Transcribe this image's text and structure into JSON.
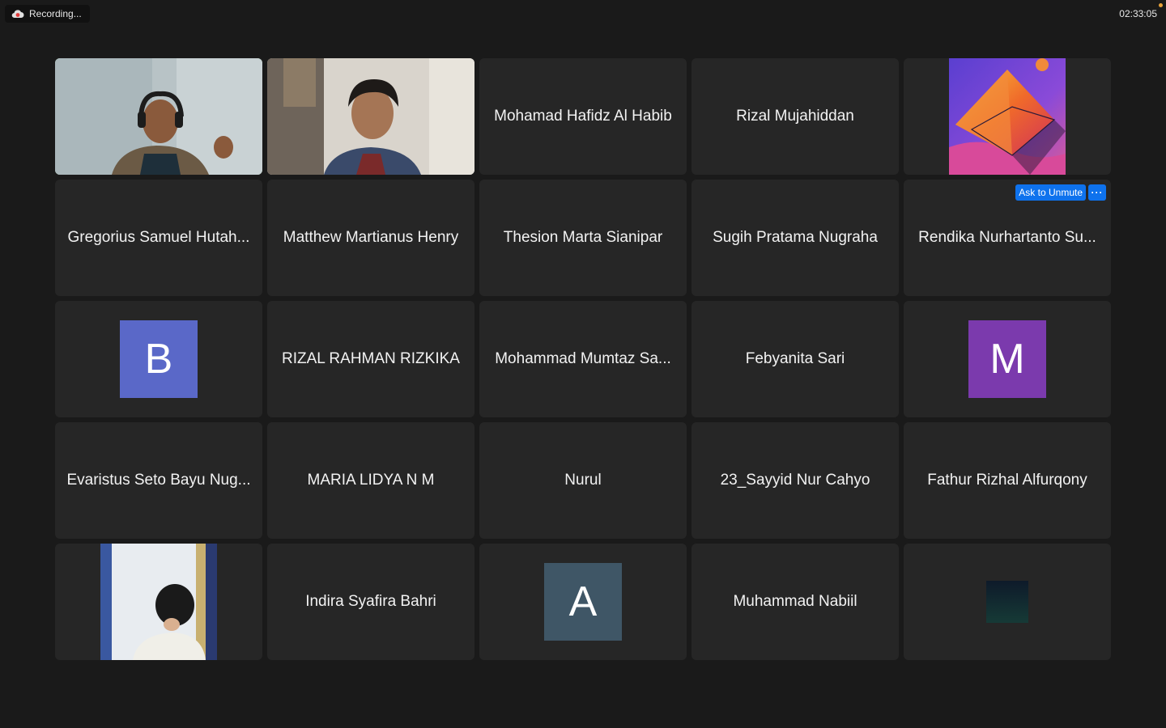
{
  "topbar": {
    "recording_label": "Recording...",
    "recording_icon": "cloud-record-icon",
    "clock": "02:33:05"
  },
  "tiles": {
    "t1": {
      "kind": "video",
      "active": true
    },
    "t2": {
      "kind": "video"
    },
    "t3": {
      "name": "Mohamad Hafidz Al Habib"
    },
    "t4": {
      "name": "Rizal Mujahiddan"
    },
    "t5": {
      "kind": "profile-image"
    },
    "t6": {
      "name": "Gregorius Samuel Hutah..."
    },
    "t7": {
      "name": "Matthew Martianus Henry"
    },
    "t8": {
      "name": "Thesion Marta Sianipar"
    },
    "t9": {
      "name": "Sugih Pratama Nugraha"
    },
    "t10": {
      "name": "Rendika Nurhartanto Su...",
      "ask_unmute": "Ask to Unmute",
      "more": "···"
    },
    "t11": {
      "initial": "B",
      "color": "#5a68c8"
    },
    "t12": {
      "name": "RIZAL RAHMAN RIZKIKA"
    },
    "t13": {
      "name": "Mohammad Mumtaz Sa..."
    },
    "t14": {
      "name": "Febyanita Sari"
    },
    "t15": {
      "initial": "M",
      "color": "#7b3aad"
    },
    "t16": {
      "name": "Evaristus Seto Bayu Nug..."
    },
    "t17": {
      "name": "MARIA LIDYA N M"
    },
    "t18": {
      "name": "Nurul"
    },
    "t19": {
      "name": "23_Sayyid Nur Cahyo"
    },
    "t20": {
      "name": "Fathur Rizhal Alfurqony"
    },
    "t21": {
      "kind": "profile-image"
    },
    "t22": {
      "name": "Indira Syafira Bahri"
    },
    "t23": {
      "initial": "A",
      "color": "#3f5666"
    },
    "t24": {
      "name": "Muhammad Nabiil"
    },
    "t25": {
      "kind": "profile-image"
    }
  }
}
